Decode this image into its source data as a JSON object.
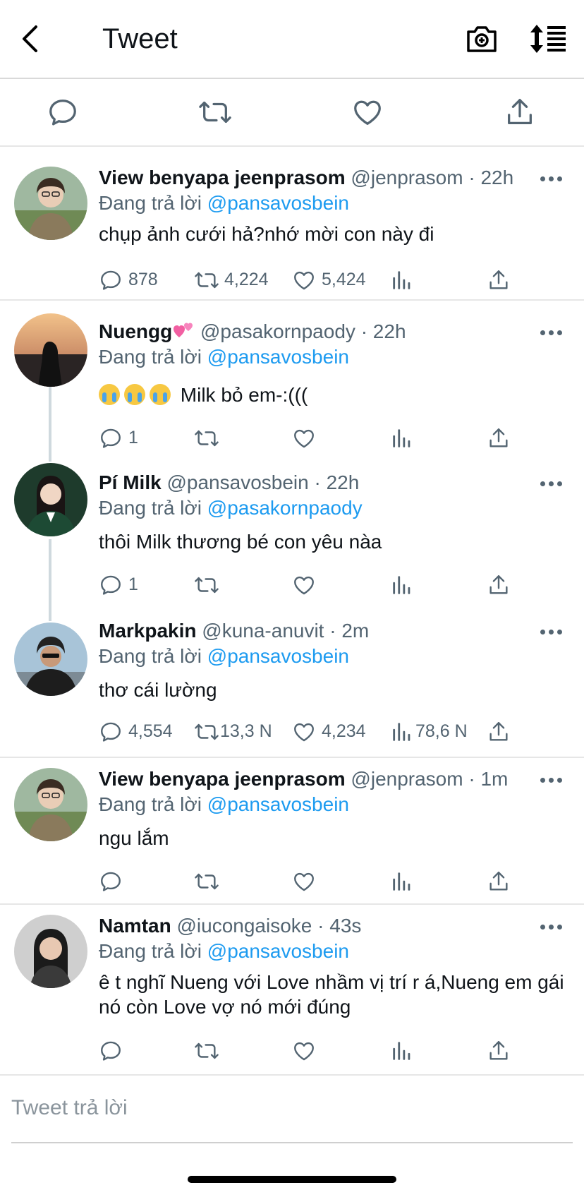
{
  "header": {
    "title": "Tweet"
  },
  "colors": {
    "accent": "#1d9bf0",
    "text": "#0f1419",
    "muted": "#536471"
  },
  "icons": [
    "back-icon",
    "camera-icon",
    "sort-icon",
    "reply-icon",
    "retweet-icon",
    "like-icon",
    "views-icon",
    "share-icon",
    "more-icon"
  ],
  "replies": [
    {
      "name": "View benyapa jeenprasom",
      "handle": "@jenprasom",
      "dot": "·",
      "time": "22h",
      "replying_label": "Đang trả lời",
      "mention": "@pansavosbein",
      "text": "chụp ảnh cưới hả?nhớ mời con này đi",
      "replies": "878",
      "retweets": "4,224",
      "likes": "5,424",
      "views": ""
    },
    {
      "name": "Nuengg",
      "handle": "@pasakornpaody",
      "dot": "·",
      "time": "22h",
      "replying_label": "Đang trả lời",
      "mention": "@pansavosbein",
      "text": "Milk bỏ em-:(((",
      "replies": "1",
      "retweets": "",
      "likes": "",
      "views": ""
    },
    {
      "name": "Pí Milk",
      "handle": "@pansavosbein",
      "dot": "·",
      "time": "22h",
      "replying_label": "Đang trả lời",
      "mention": "@pasakornpaody",
      "text": "thôi Milk thương bé con yêu nàa",
      "replies": "1",
      "retweets": "",
      "likes": "",
      "views": ""
    },
    {
      "name": "Markpakin",
      "handle": "@kuna-anuvit",
      "dot": "·",
      "time": "2m",
      "replying_label": "Đang trả lời",
      "mention": "@pansavosbein",
      "text": "thơ cái lường",
      "replies": "4,554",
      "retweets": "13,3 N",
      "likes": "4,234",
      "views": "78,6 N"
    },
    {
      "name": "View benyapa jeenprasom",
      "handle": "@jenprasom",
      "dot": "·",
      "time": "1m",
      "replying_label": "Đang trả lời",
      "mention": "@pansavosbein",
      "text": "ngu lắm",
      "replies": "",
      "retweets": "",
      "likes": "",
      "views": ""
    },
    {
      "name": "Namtan",
      "handle": "@iucongaisoke",
      "dot": "·",
      "time": "43s",
      "replying_label": "Đang trả lời",
      "mention": "@pansavosbein",
      "text": "ê t nghĩ Nueng với Love nhầm vị trí r á,Nueng em gái nó còn Love vợ nó mới đúng",
      "replies": "",
      "retweets": "",
      "likes": "",
      "views": ""
    }
  ],
  "composer": {
    "placeholder": "Tweet trả lời"
  }
}
